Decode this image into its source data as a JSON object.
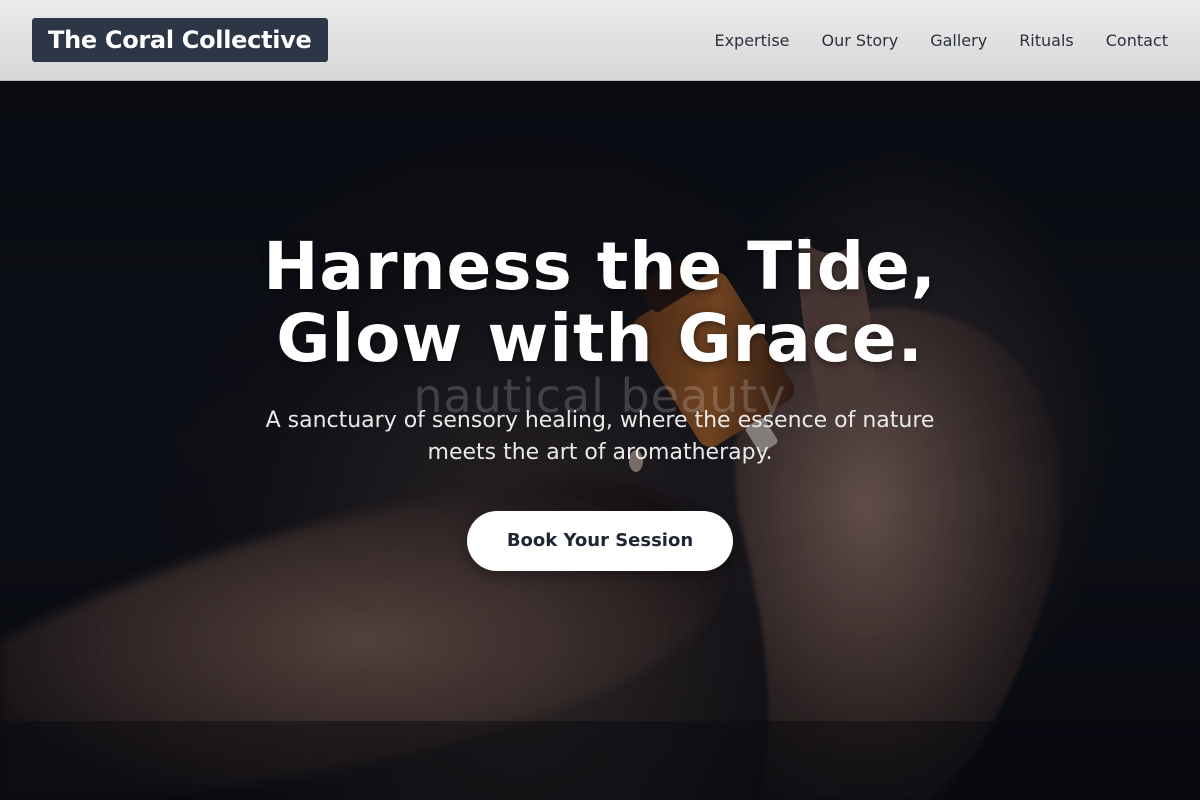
{
  "header": {
    "brand": "The Coral Collective",
    "nav": [
      {
        "label": "Expertise"
      },
      {
        "label": "Our Story"
      },
      {
        "label": "Gallery"
      },
      {
        "label": "Rituals"
      },
      {
        "label": "Contact"
      }
    ]
  },
  "hero": {
    "background_image": "hands-applying-essential-oil-dropper-photo",
    "watermark": "nautical beauty",
    "headline_line1": "Harness the Tide,",
    "headline_line2": "Glow with Grace.",
    "subtitle": "A sanctuary of sensory healing, where the essence of nature meets the art of aromatherapy.",
    "cta_label": "Book Your Session"
  },
  "colors": {
    "brand_bg": "#2d3646",
    "header_bg": "#e3e3e3",
    "hero_bg": "#0b0e13",
    "cta_bg": "#ffffff",
    "cta_text": "#1f2633"
  }
}
